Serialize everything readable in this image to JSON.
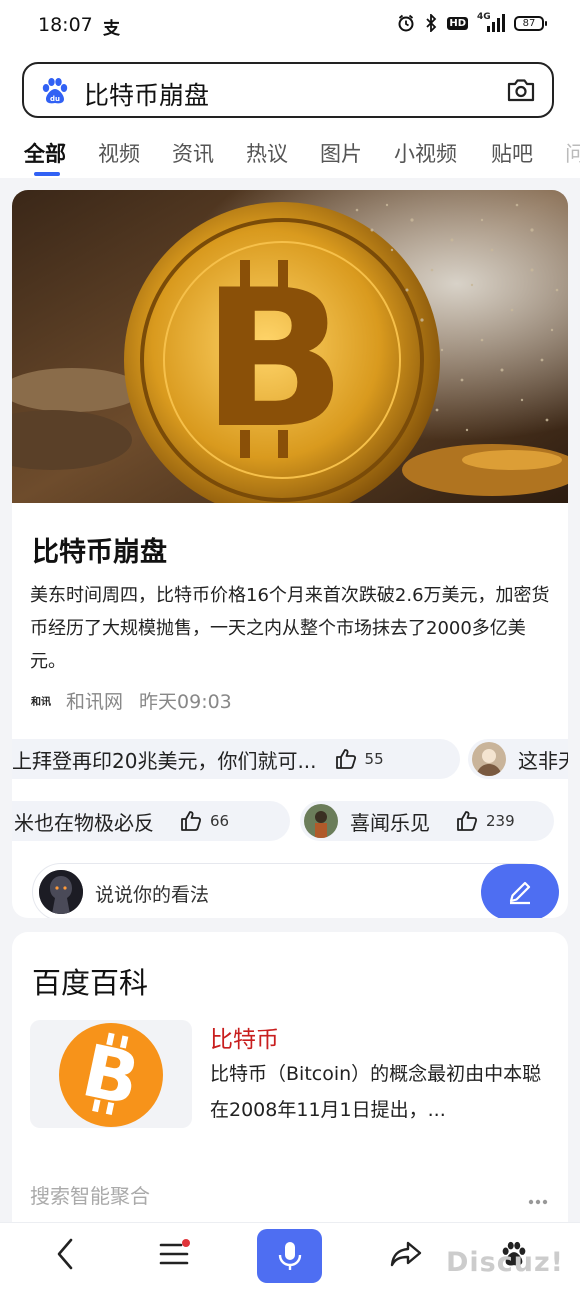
{
  "status_bar": {
    "time": "18:07",
    "notification_icon": "支",
    "network": "4G",
    "hd": "HD",
    "battery": "87"
  },
  "search": {
    "query": "比特币崩盘"
  },
  "tabs": [
    "全部",
    "视频",
    "资讯",
    "热议",
    "图片",
    "小视频",
    "贴吧",
    "问"
  ],
  "news": {
    "title": "比特币崩盘",
    "body": "美东时间周四，比特币价格16个月来首次跌破2.6万美元，加密货币经历了大规模抛售，一天之内从整个市场抹去了2000多亿美元。",
    "source_logo": "和讯",
    "source": "和讯网",
    "time": "昨天09:03"
  },
  "comments_row1": [
    {
      "text": "上拜登再印20兆美元，你们就可...",
      "likes": "55"
    },
    {
      "text": "这非天",
      "likes": ""
    }
  ],
  "comments_row2": [
    {
      "text": "米也在物极必反",
      "likes": "66"
    },
    {
      "text": "喜闻乐见",
      "likes": "239"
    }
  ],
  "opinion": {
    "placeholder": "说说你的看法"
  },
  "baike": {
    "header": "百度百科",
    "title": "比特币",
    "desc": "比特币（Bitcoin）的概念最初由中本聪在2008年11月1日提出，..."
  },
  "aggregate": {
    "label": "搜索智能聚合"
  },
  "watermark": "Discuz!",
  "colors": {
    "accent": "#4e6ef2",
    "tab_indicator": "#3161f4",
    "baike_title": "#c81e1e",
    "bitcoin_orange": "#f7931a"
  }
}
